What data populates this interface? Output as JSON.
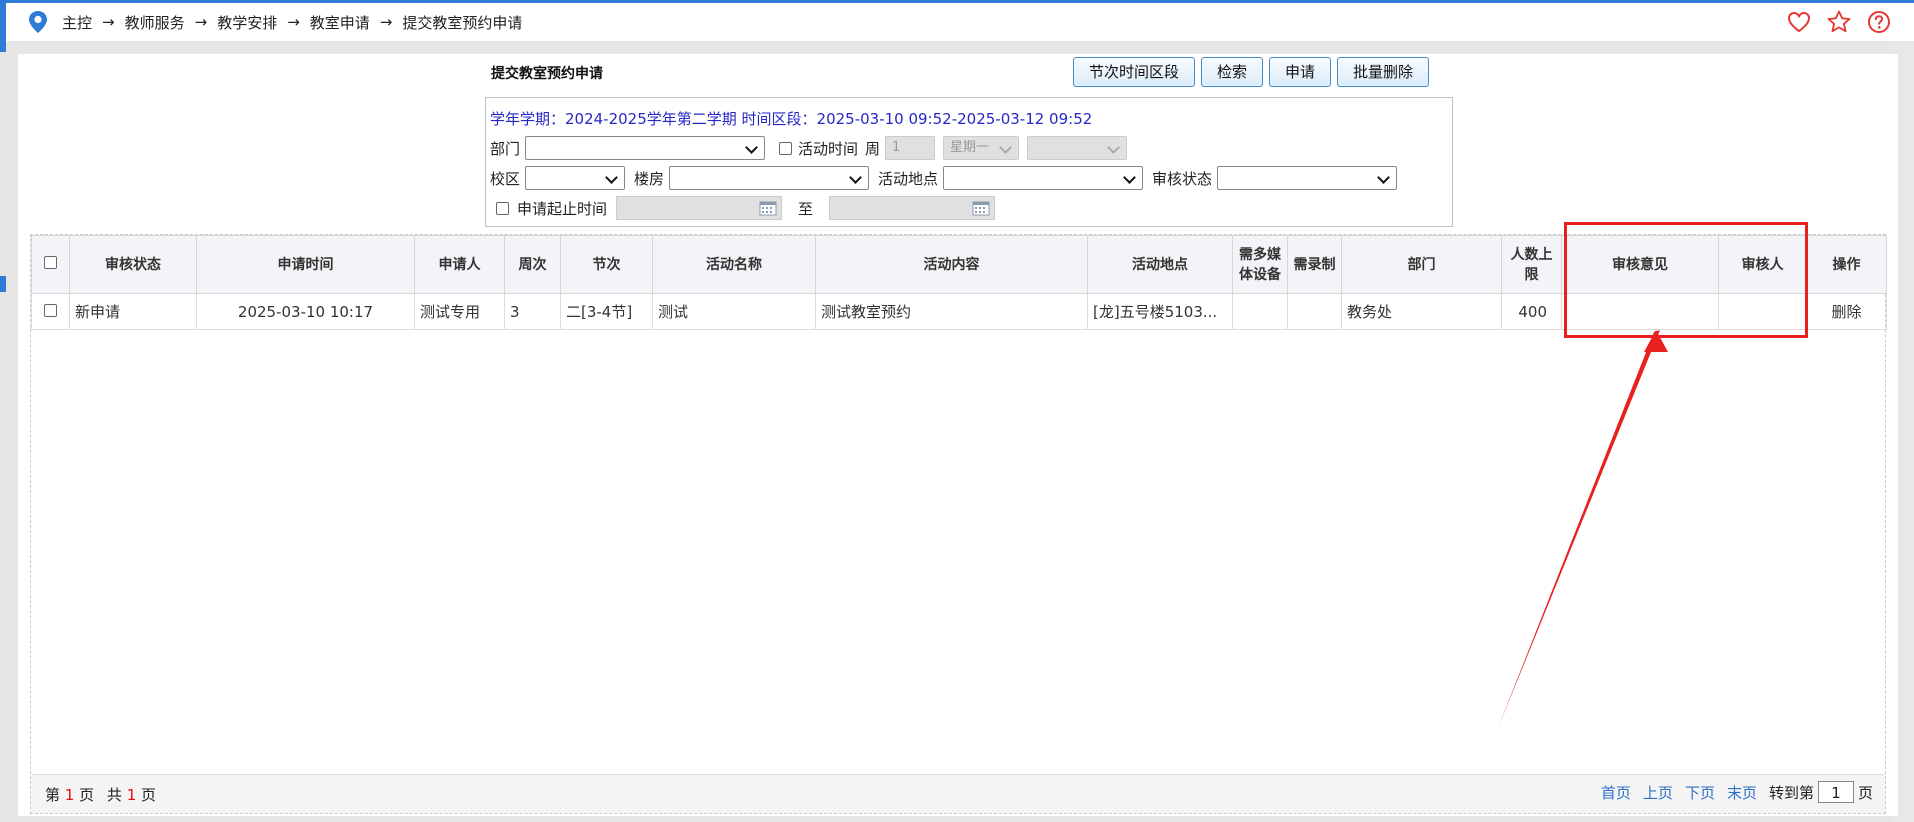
{
  "breadcrumb": [
    "主控",
    "教师服务",
    "教学安排",
    "教室申请",
    "提交教室预约申请"
  ],
  "breadcrumb_separator": "→",
  "form": {
    "title": "提交教室预约申请",
    "buttons": {
      "period": "节次时间区段",
      "search": "检索",
      "apply": "申请",
      "batch_delete": "批量删除"
    },
    "info_line": "学年学期：2024-2025学年第二学期  时间区段：2025-03-10 09:52-2025-03-12 09:52",
    "labels": {
      "department": "部门",
      "activity_time": "活动时间",
      "week": "周",
      "campus": "校区",
      "building": "楼房",
      "location": "活动地点",
      "review_status": "审核状态",
      "apply_period": "申请起止时间",
      "to": "至"
    },
    "week_value": "1",
    "weekday_value": "星期一"
  },
  "table": {
    "headers": [
      "审核状态",
      "申请时间",
      "申请人",
      "周次",
      "节次",
      "活动名称",
      "活动内容",
      "活动地点",
      "需多媒体设备",
      "需录制",
      "部门",
      "人数上限",
      "审核意见",
      "审核人",
      "操作"
    ],
    "rows": [
      {
        "status": "新申请",
        "time": "2025-03-10 10:17",
        "applicant": "测试专用",
        "week": "3",
        "period": "二[3-4节]",
        "name": "测试",
        "content": "测试教室预约",
        "location": "[龙]五号楼5103...",
        "media": "",
        "record": "",
        "dept": "教务处",
        "capacity": "400",
        "opinion": "",
        "reviewer": "",
        "action": "删除"
      }
    ]
  },
  "pager": {
    "page_prefix": "第",
    "current_page": "1",
    "page_unit": "页",
    "total_prefix": "共",
    "total_pages": "1",
    "total_unit": "页",
    "first": "首页",
    "prev": "上页",
    "next": "下页",
    "last": "末页",
    "goto_label": "转到第",
    "goto_value": "1",
    "goto_unit": "页"
  },
  "colors": {
    "accent": "#2e7cd6",
    "link": "#2f6fc7",
    "info_text": "#2727c8",
    "annotation": "#e8201e",
    "icon_red": "#e53935"
  }
}
